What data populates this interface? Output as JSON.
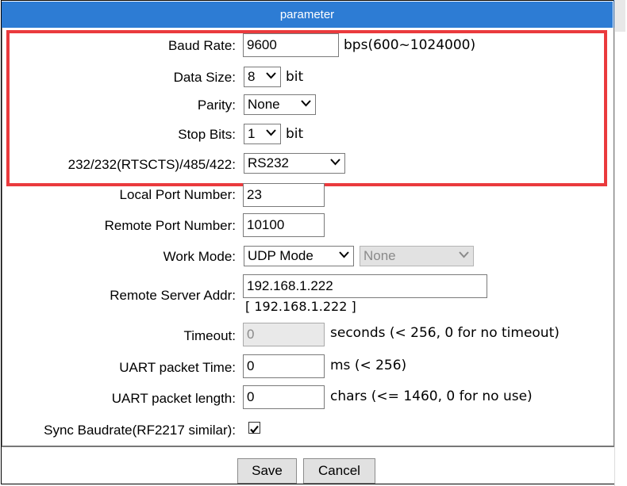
{
  "panel": {
    "title": "parameter"
  },
  "serial": {
    "baud_rate": {
      "label": "Baud Rate:",
      "value": "9600",
      "unit": "bps(600~1024000)"
    },
    "data_size": {
      "label": "Data Size:",
      "value": "8",
      "unit": "bit"
    },
    "parity": {
      "label": "Parity:",
      "value": "None"
    },
    "stop_bits": {
      "label": "Stop Bits:",
      "value": "1",
      "unit": "bit"
    },
    "interface": {
      "label": "232/232(RTSCTS)/485/422:",
      "value": "RS232"
    }
  },
  "network": {
    "local_port": {
      "label": "Local Port Number:",
      "value": "23"
    },
    "remote_port": {
      "label": "Remote Port Number:",
      "value": "10100"
    },
    "work_mode": {
      "label": "Work Mode:",
      "value": "UDP Mode",
      "secondary_value": "None"
    },
    "remote_server": {
      "label": "Remote Server Addr:",
      "value": "192.168.1.222",
      "resolved": "[ 192.168.1.222 ]"
    },
    "timeout": {
      "label": "Timeout:",
      "value": "0",
      "unit": "seconds (< 256, 0 for no timeout)"
    },
    "uart_packet_time": {
      "label": "UART packet Time:",
      "value": "0",
      "unit": "ms (< 256)"
    },
    "uart_packet_length": {
      "label": "UART packet length:",
      "value": "0",
      "unit": "chars (<= 1460, 0 for no use)"
    },
    "sync_baudrate": {
      "label": "Sync Baudrate(RF2217 similar):",
      "checked": true
    }
  },
  "actions": {
    "save": "Save",
    "cancel": "Cancel"
  },
  "colors": {
    "header_bg": "#2d7cd4",
    "highlight": "#ea3a3d"
  }
}
